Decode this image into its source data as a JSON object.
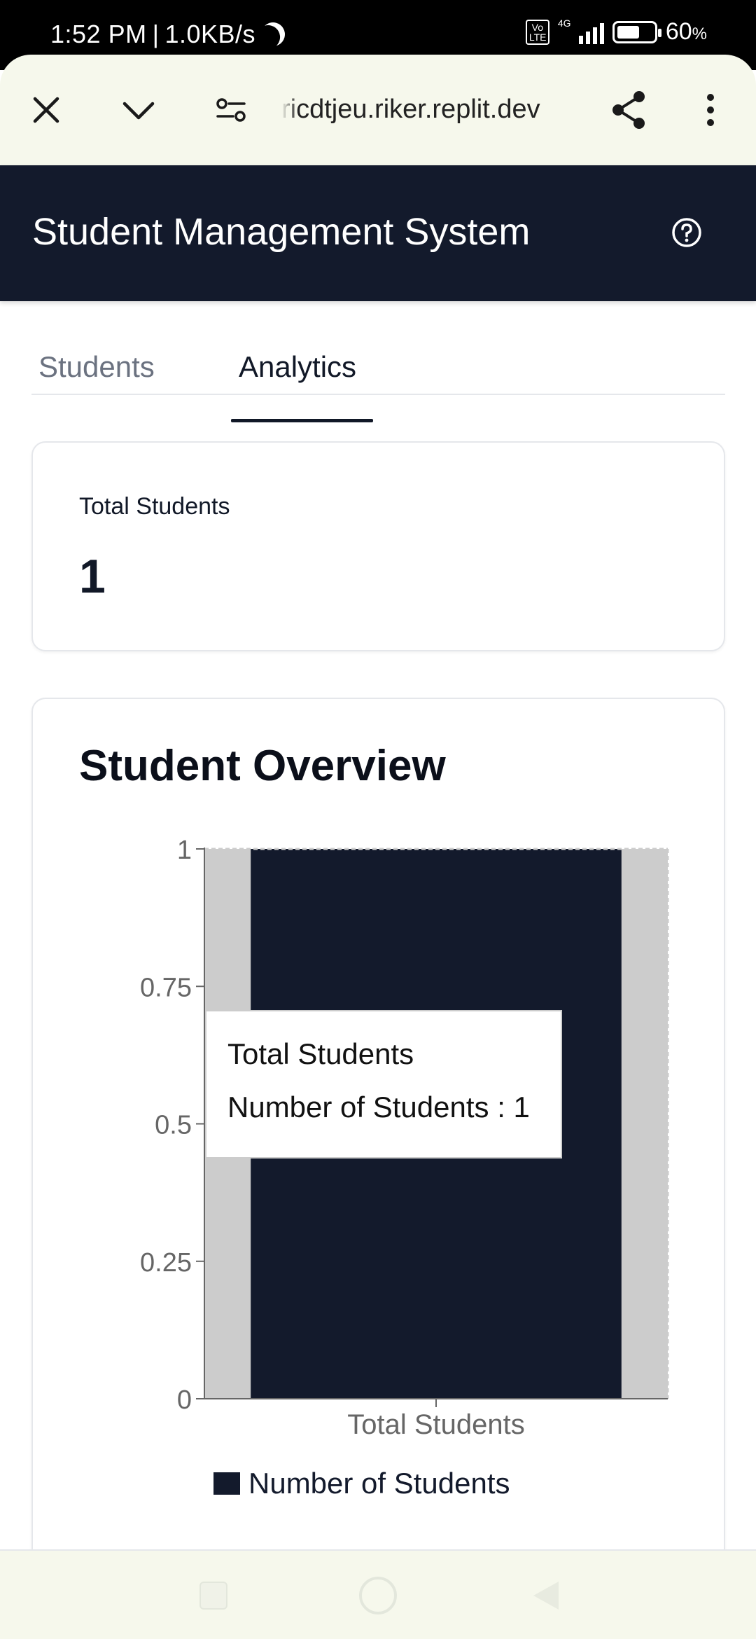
{
  "status_bar": {
    "time": "1:52 PM",
    "network_speed": "1.0KB/s",
    "volte_label": "Vo LTE",
    "network_type": "4G",
    "battery_percent": "60",
    "battery_unit": "%",
    "battery_level": 0.6
  },
  "browser": {
    "url": "ricdtjeu.riker.replit.dev",
    "icons": [
      "close-icon",
      "chevron-down-icon",
      "site-settings-icon",
      "share-icon",
      "more-vert-icon"
    ]
  },
  "app": {
    "title": "Student Management System",
    "header_color": "#131a2c",
    "help_icon": "help-circle-icon"
  },
  "tabs": [
    {
      "label": "Students",
      "active": false
    },
    {
      "label": "Analytics",
      "active": true
    }
  ],
  "stats": {
    "total_students_label": "Total Students",
    "total_students_value": "1"
  },
  "chart_card": {
    "title": "Student Overview"
  },
  "tooltip": {
    "label": "Total Students",
    "item": "Number of Students : 1"
  },
  "chart_data": {
    "type": "bar",
    "categories": [
      "Total Students"
    ],
    "series": [
      {
        "name": "Number of Students",
        "values": [
          1
        ],
        "color": "#131a2c"
      }
    ],
    "ylim": [
      0,
      1
    ],
    "yticks": [
      "0",
      "0.25",
      "0.5",
      "0.75",
      "1"
    ],
    "hover_highlight_color": "#cccccc",
    "legend_position": "bottom",
    "grid": false
  },
  "nav": {
    "icons": [
      "recents-square-icon",
      "home-circle-icon",
      "back-triangle-icon"
    ]
  }
}
